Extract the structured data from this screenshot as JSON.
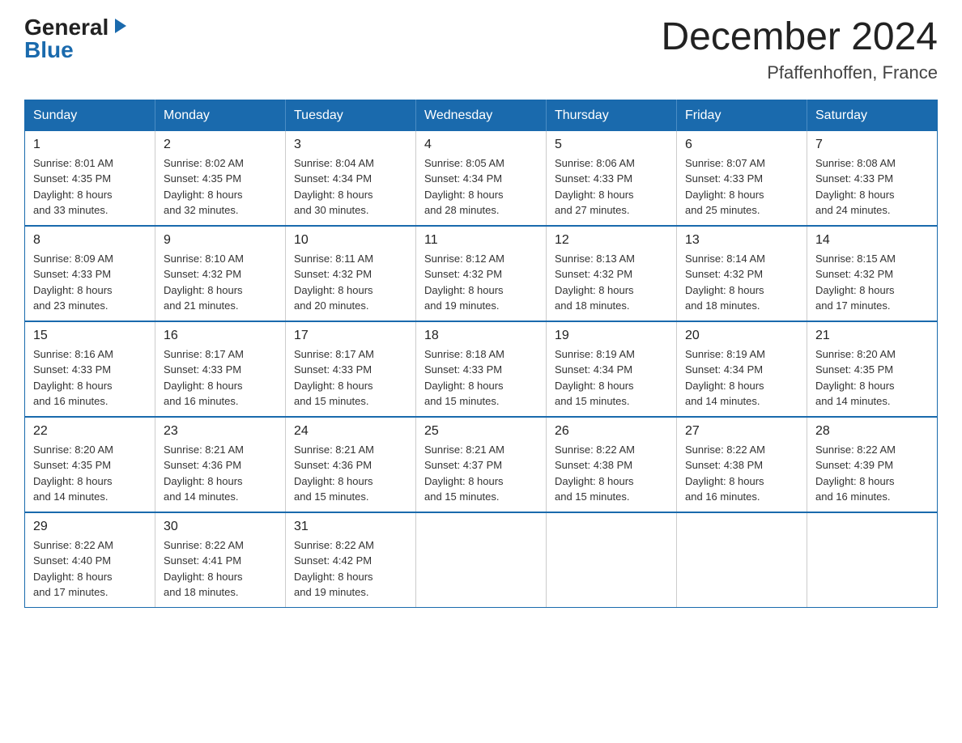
{
  "header": {
    "logo_general": "General",
    "logo_blue": "Blue",
    "month_title": "December 2024",
    "location": "Pfaffenhoffen, France"
  },
  "days_of_week": [
    "Sunday",
    "Monday",
    "Tuesday",
    "Wednesday",
    "Thursday",
    "Friday",
    "Saturday"
  ],
  "weeks": [
    [
      {
        "day": "1",
        "sunrise": "8:01 AM",
        "sunset": "4:35 PM",
        "daylight": "8 hours and 33 minutes."
      },
      {
        "day": "2",
        "sunrise": "8:02 AM",
        "sunset": "4:35 PM",
        "daylight": "8 hours and 32 minutes."
      },
      {
        "day": "3",
        "sunrise": "8:04 AM",
        "sunset": "4:34 PM",
        "daylight": "8 hours and 30 minutes."
      },
      {
        "day": "4",
        "sunrise": "8:05 AM",
        "sunset": "4:34 PM",
        "daylight": "8 hours and 28 minutes."
      },
      {
        "day": "5",
        "sunrise": "8:06 AM",
        "sunset": "4:33 PM",
        "daylight": "8 hours and 27 minutes."
      },
      {
        "day": "6",
        "sunrise": "8:07 AM",
        "sunset": "4:33 PM",
        "daylight": "8 hours and 25 minutes."
      },
      {
        "day": "7",
        "sunrise": "8:08 AM",
        "sunset": "4:33 PM",
        "daylight": "8 hours and 24 minutes."
      }
    ],
    [
      {
        "day": "8",
        "sunrise": "8:09 AM",
        "sunset": "4:33 PM",
        "daylight": "8 hours and 23 minutes."
      },
      {
        "day": "9",
        "sunrise": "8:10 AM",
        "sunset": "4:32 PM",
        "daylight": "8 hours and 21 minutes."
      },
      {
        "day": "10",
        "sunrise": "8:11 AM",
        "sunset": "4:32 PM",
        "daylight": "8 hours and 20 minutes."
      },
      {
        "day": "11",
        "sunrise": "8:12 AM",
        "sunset": "4:32 PM",
        "daylight": "8 hours and 19 minutes."
      },
      {
        "day": "12",
        "sunrise": "8:13 AM",
        "sunset": "4:32 PM",
        "daylight": "8 hours and 18 minutes."
      },
      {
        "day": "13",
        "sunrise": "8:14 AM",
        "sunset": "4:32 PM",
        "daylight": "8 hours and 18 minutes."
      },
      {
        "day": "14",
        "sunrise": "8:15 AM",
        "sunset": "4:32 PM",
        "daylight": "8 hours and 17 minutes."
      }
    ],
    [
      {
        "day": "15",
        "sunrise": "8:16 AM",
        "sunset": "4:33 PM",
        "daylight": "8 hours and 16 minutes."
      },
      {
        "day": "16",
        "sunrise": "8:17 AM",
        "sunset": "4:33 PM",
        "daylight": "8 hours and 16 minutes."
      },
      {
        "day": "17",
        "sunrise": "8:17 AM",
        "sunset": "4:33 PM",
        "daylight": "8 hours and 15 minutes."
      },
      {
        "day": "18",
        "sunrise": "8:18 AM",
        "sunset": "4:33 PM",
        "daylight": "8 hours and 15 minutes."
      },
      {
        "day": "19",
        "sunrise": "8:19 AM",
        "sunset": "4:34 PM",
        "daylight": "8 hours and 15 minutes."
      },
      {
        "day": "20",
        "sunrise": "8:19 AM",
        "sunset": "4:34 PM",
        "daylight": "8 hours and 14 minutes."
      },
      {
        "day": "21",
        "sunrise": "8:20 AM",
        "sunset": "4:35 PM",
        "daylight": "8 hours and 14 minutes."
      }
    ],
    [
      {
        "day": "22",
        "sunrise": "8:20 AM",
        "sunset": "4:35 PM",
        "daylight": "8 hours and 14 minutes."
      },
      {
        "day": "23",
        "sunrise": "8:21 AM",
        "sunset": "4:36 PM",
        "daylight": "8 hours and 14 minutes."
      },
      {
        "day": "24",
        "sunrise": "8:21 AM",
        "sunset": "4:36 PM",
        "daylight": "8 hours and 15 minutes."
      },
      {
        "day": "25",
        "sunrise": "8:21 AM",
        "sunset": "4:37 PM",
        "daylight": "8 hours and 15 minutes."
      },
      {
        "day": "26",
        "sunrise": "8:22 AM",
        "sunset": "4:38 PM",
        "daylight": "8 hours and 15 minutes."
      },
      {
        "day": "27",
        "sunrise": "8:22 AM",
        "sunset": "4:38 PM",
        "daylight": "8 hours and 16 minutes."
      },
      {
        "day": "28",
        "sunrise": "8:22 AM",
        "sunset": "4:39 PM",
        "daylight": "8 hours and 16 minutes."
      }
    ],
    [
      {
        "day": "29",
        "sunrise": "8:22 AM",
        "sunset": "4:40 PM",
        "daylight": "8 hours and 17 minutes."
      },
      {
        "day": "30",
        "sunrise": "8:22 AM",
        "sunset": "4:41 PM",
        "daylight": "8 hours and 18 minutes."
      },
      {
        "day": "31",
        "sunrise": "8:22 AM",
        "sunset": "4:42 PM",
        "daylight": "8 hours and 19 minutes."
      },
      null,
      null,
      null,
      null
    ]
  ],
  "labels": {
    "sunrise": "Sunrise:",
    "sunset": "Sunset:",
    "daylight": "Daylight:"
  }
}
